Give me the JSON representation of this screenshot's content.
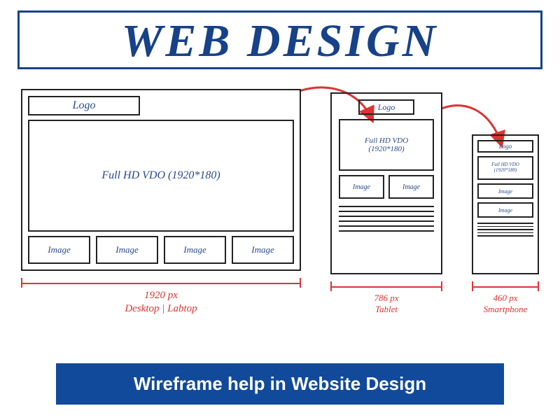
{
  "header": {
    "title": "WEB DESIGN"
  },
  "devices": {
    "desktop": {
      "logo": "Logo",
      "hero": "Full HD VDO (1920*180)",
      "thumbs": [
        "Image",
        "Image",
        "Image",
        "Image"
      ],
      "width_label": "1920 px",
      "device_label": "Desktop | Labtop"
    },
    "tablet": {
      "logo": "Logo",
      "hero_line1": "Full HD VDO",
      "hero_line2": "(1920*180)",
      "thumbs": [
        "Image",
        "Image"
      ],
      "width_label": "786 px",
      "device_label": "Tablet"
    },
    "phone": {
      "logo": "Logo",
      "hero_line1": "Full HD VDO",
      "hero_line2": "(1920*180)",
      "thumbs": [
        "Image",
        "Image"
      ],
      "width_label": "460 px",
      "device_label": "Smartphone"
    }
  },
  "banner": {
    "text": "Wireframe help in Website Design"
  }
}
